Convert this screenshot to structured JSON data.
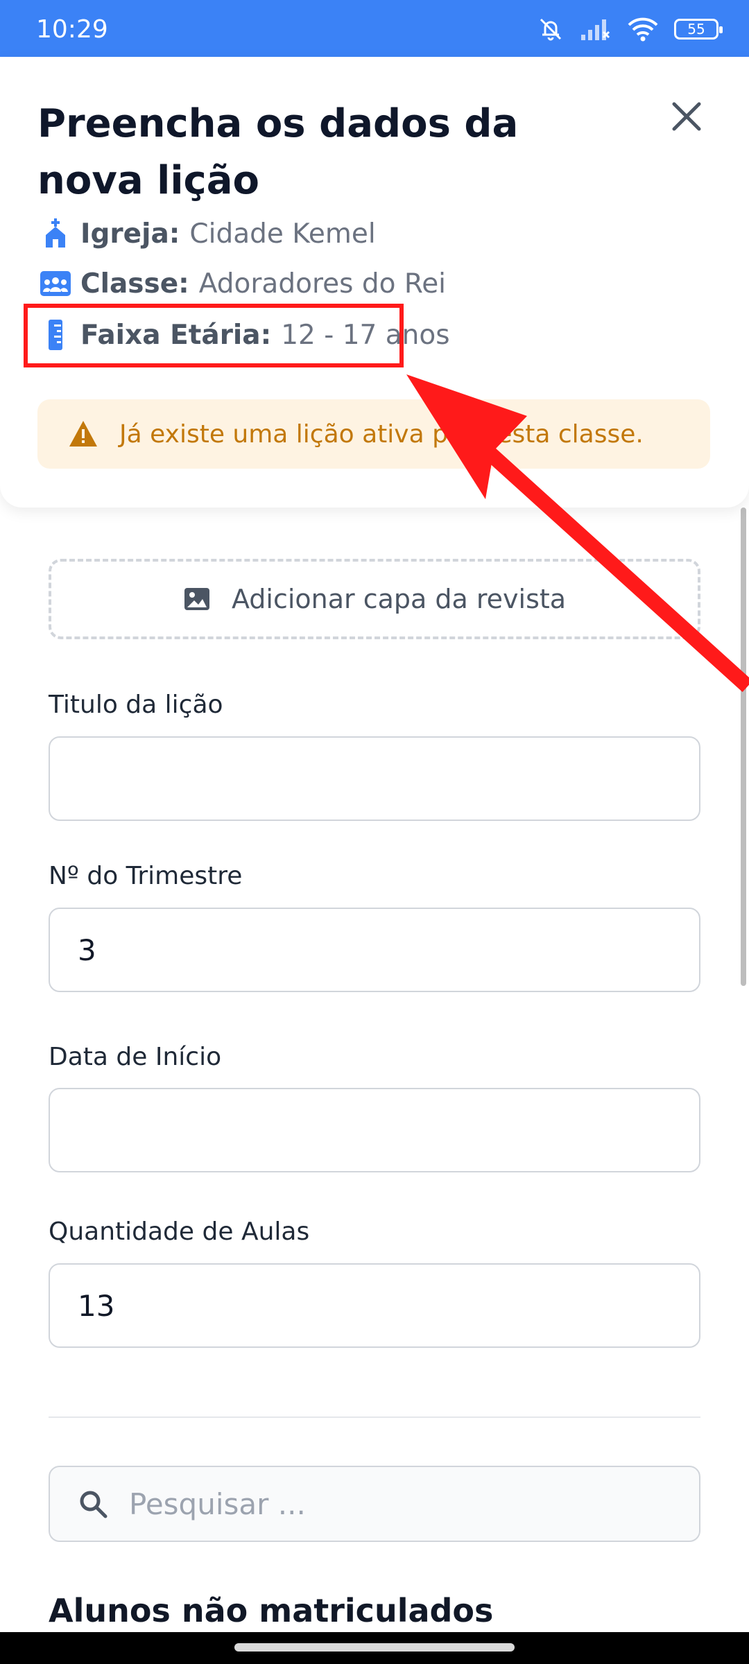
{
  "status_bar": {
    "time": "10:29",
    "battery": "55"
  },
  "header": {
    "title": "Preencha os dados da nova lição",
    "info": [
      {
        "label": "Igreja:",
        "value": "Cidade Kemel",
        "icon": "church-icon"
      },
      {
        "label": "Classe:",
        "value": "Adoradores do Rei",
        "icon": "users-icon"
      },
      {
        "label": "Faixa Etária:",
        "value": "12 - 17 anos",
        "icon": "ruler-icon"
      }
    ],
    "alert": "Já existe uma lição ativa para esta classe."
  },
  "form": {
    "cover_button": "Adicionar capa da revista",
    "fields": [
      {
        "label": "Titulo da lição",
        "value": ""
      },
      {
        "label": "Nº do Trimestre",
        "value": "3"
      },
      {
        "label": "Data de Início",
        "value": ""
      },
      {
        "label": "Quantidade de Aulas",
        "value": "13"
      }
    ],
    "search_placeholder": "Pesquisar ...",
    "section_title": "Alunos não matriculados"
  },
  "colors": {
    "accent": "#3b82f6",
    "alert_bg": "#fef3e2",
    "alert_text": "#c2780a",
    "annotation": "#ff1a1a"
  }
}
